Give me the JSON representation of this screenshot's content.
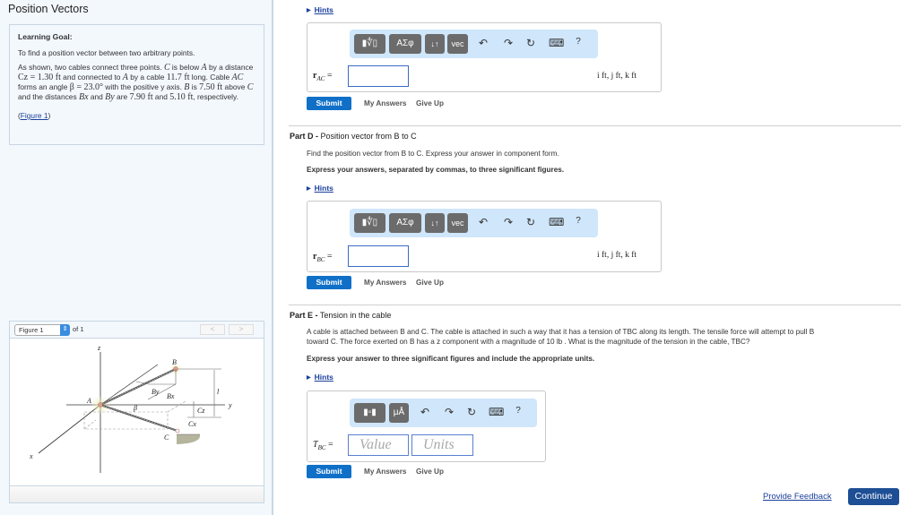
{
  "page": {
    "title": "Position Vectors"
  },
  "learning_goal": {
    "heading": "Learning Goal:",
    "intro": "To find a position vector between two arbitrary points.",
    "body_parts": [
      "As shown, two cables connect three points. ",
      "C",
      " is below ",
      "A",
      " by a distance ",
      "Cz = 1.30 ft",
      " and connected to ",
      "A",
      " by a cable ",
      "11.7 ft",
      " long. Cable ",
      "AC",
      " forms an angle ",
      "β = 23.0°",
      " with the positive y axis. ",
      "B",
      " is ",
      "7.50 ft",
      " above ",
      "C",
      " and the distances ",
      "Bx",
      " and ",
      "By",
      " are ",
      "7.90 ft",
      " and ",
      "5.10 ft",
      ", respectively."
    ],
    "figure_link": "Figure 1",
    "figure_link_open": "(",
    "figure_link_close": ")"
  },
  "figure_panel": {
    "selected": "Figure 1",
    "of_label": "of 1",
    "prev": "<",
    "next": ">",
    "labels": {
      "z": "z",
      "y": "y",
      "x": "x",
      "A": "A",
      "B": "B",
      "C": "C",
      "By": "By",
      "Bx": "Bx",
      "beta": "β",
      "Cz": "Cz",
      "Cx": "Cx",
      "l": "l"
    }
  },
  "toolbar": {
    "template_btn": "▮∜▯",
    "greek_btn": "ΑΣφ",
    "sort_btn": "↓↑",
    "vec_btn": "vec",
    "units_tpl_btn": "▮▫▮",
    "units_btn": "μÅ",
    "undo": "↶",
    "redo": "↷",
    "reset": "↻",
    "keyboard": "⌨",
    "help": "?"
  },
  "part_c": {
    "hints": "Hints",
    "label_r": "r",
    "label_sub": "AC",
    "label_eq": " =",
    "input_value": "",
    "units": "i ft, j ft, k ft",
    "submit": "Submit",
    "my_answers": "My Answers",
    "give_up": "Give Up"
  },
  "part_d": {
    "part": "Part D -",
    "title": "Position vector from B to C",
    "prompt": "Find the position vector from B to C. Express your answer in component form.",
    "instruction": "Express your answers, separated by commas, to three significant figures.",
    "hints": "Hints",
    "label_r": "r",
    "label_sub": "BC",
    "label_eq": " =",
    "input_value": "",
    "units": "i ft, j ft, k ft",
    "submit": "Submit",
    "my_answers": "My Answers",
    "give_up": "Give Up"
  },
  "part_e": {
    "part": "Part E -",
    "title": "Tension in the cable",
    "prompt_line1": "A cable is attached between B and C. The cable is attached in such a way that it has a tension of TBC along its length. The tensile force will attempt to pull B",
    "prompt_line2": "toward C. The force exerted on B has a z component with a magnitude of 10 lb . What is the magnitude of the tension in the cable, TBC?",
    "instruction": "Express your answer to three significant figures and include the appropriate units.",
    "hints": "Hints",
    "label_T": "T",
    "label_sub": "BC",
    "label_eq": " =",
    "value_placeholder": "Value",
    "units_placeholder": "Units",
    "submit": "Submit",
    "my_answers": "My Answers",
    "give_up": "Give Up"
  },
  "footer": {
    "feedback": "Provide Feedback",
    "continue": "Continue"
  }
}
